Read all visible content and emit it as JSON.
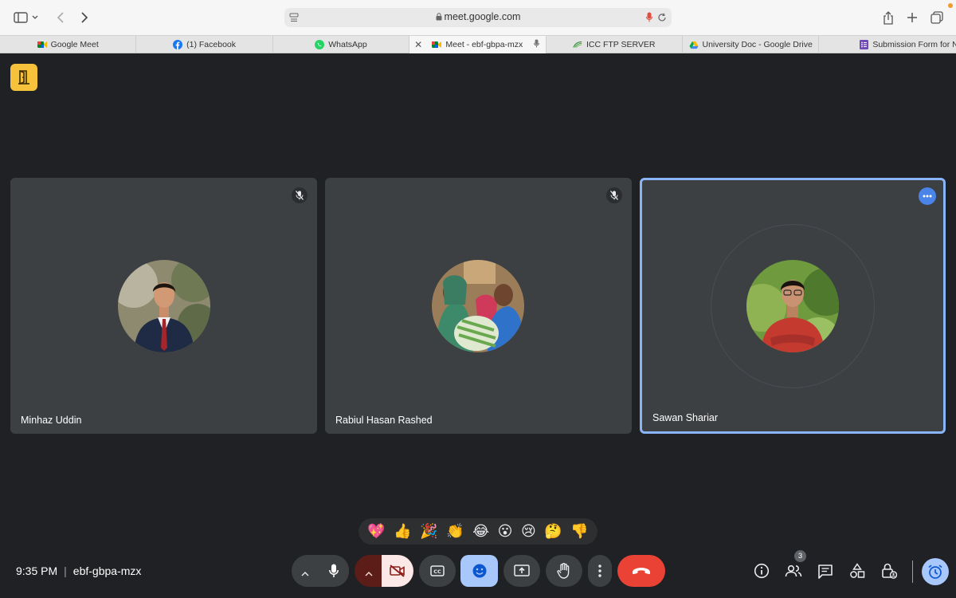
{
  "browser": {
    "url": "meet.google.com",
    "tabs": [
      {
        "label": "Google Meet",
        "favicon": "meet-icon",
        "active": false
      },
      {
        "label": "(1) Facebook",
        "favicon": "facebook-icon",
        "active": false
      },
      {
        "label": "WhatsApp",
        "favicon": "whatsapp-icon",
        "active": false
      },
      {
        "label": "Meet - ebf-gbpa-mzx",
        "favicon": "meet-icon",
        "active": true
      },
      {
        "label": "ICC FTP SERVER",
        "favicon": "icc-icon",
        "active": false
      },
      {
        "label": "University Doc - Google Drive",
        "favicon": "drive-icon",
        "active": false
      },
      {
        "label": "Submission Form for New o...",
        "favicon": "forms-icon",
        "active": false
      }
    ]
  },
  "meeting": {
    "time": "9:35 PM",
    "code": "ebf-gbpa-mzx",
    "participant_count": "3"
  },
  "participants": [
    {
      "name": "Minhaz Uddin",
      "muted": true,
      "speaking": false
    },
    {
      "name": "Rabiul Hasan Rashed",
      "muted": true,
      "speaking": false
    },
    {
      "name": "Sawan Shariar",
      "muted": false,
      "speaking": true
    }
  ],
  "reactions": [
    "💖",
    "👍",
    "🎉",
    "👏",
    "😂",
    "😮",
    "😢",
    "🤔",
    "👎"
  ],
  "colors": {
    "background": "#202124",
    "tile": "#3c4043",
    "accent_blue": "#8ab4f8",
    "end_call_red": "#ea4335",
    "meet_yellow": "#f6c23c"
  }
}
